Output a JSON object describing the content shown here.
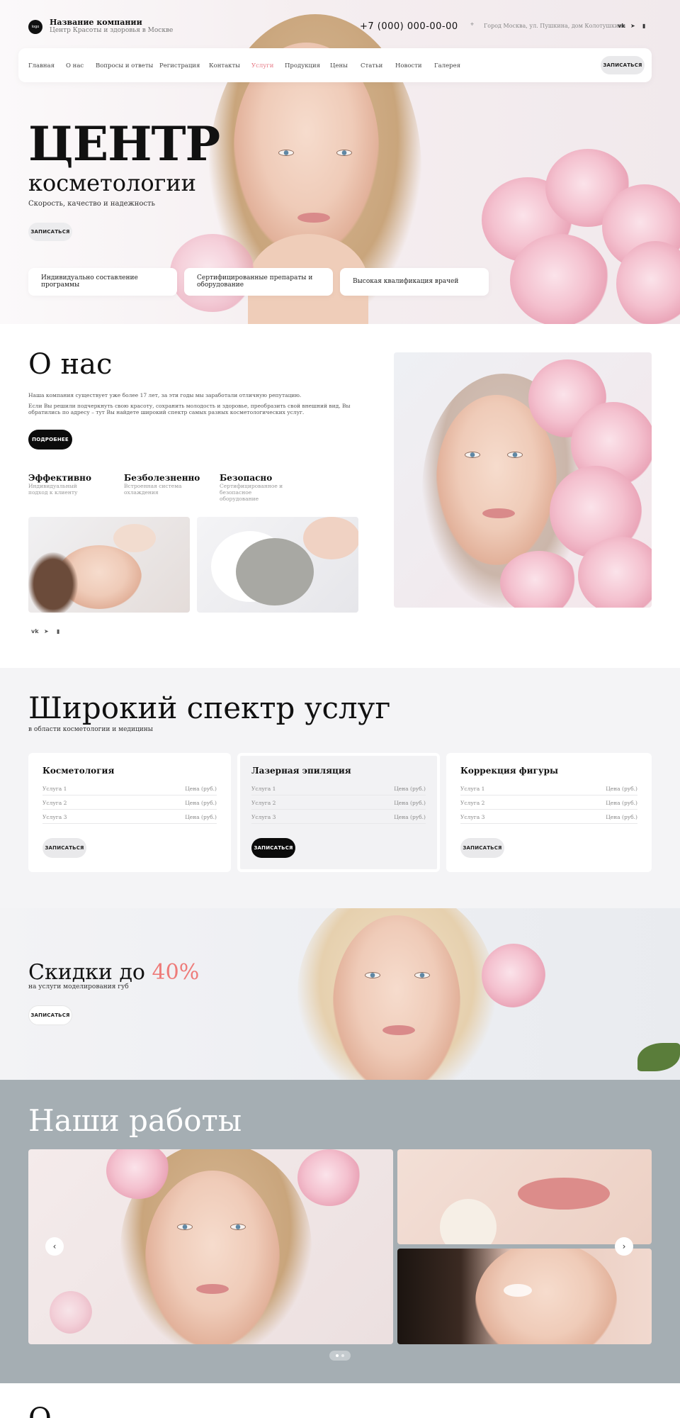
{
  "header": {
    "logo_text": "logo",
    "company_name": "Название компании",
    "company_sub": "Центр Красоты и здоровья в Москве",
    "phone": "+7 (000) 000-00-00",
    "address": "Город Москва, ул. Пушкина, дом Колотушкина",
    "social_icons": [
      "vk-icon",
      "telegram-icon",
      "phone-icon"
    ]
  },
  "nav": {
    "items": [
      {
        "label": "Главная",
        "active": false
      },
      {
        "label": "О нас",
        "active": false
      },
      {
        "label": "Вопросы и ответы",
        "active": false
      },
      {
        "label": "Регистрация",
        "active": false
      },
      {
        "label": "Контакты",
        "active": false
      },
      {
        "label": "Услуги",
        "active": true
      },
      {
        "label": "Продукция",
        "active": false
      },
      {
        "label": "Цены",
        "active": false
      },
      {
        "label": "Статьи",
        "active": false
      },
      {
        "label": "Новости",
        "active": false
      },
      {
        "label": "Галерея",
        "active": false
      }
    ],
    "cta_label": "ЗАПИСАТЬСЯ",
    "active_color": "#e77a86"
  },
  "hero": {
    "title": "ЦЕНТР",
    "subtitle": "косметологии",
    "tagline": "Скорость, качество и надежность",
    "cta_label": "ЗАПИСАТЬСЯ",
    "cards": [
      "Индивидуально составление программы",
      "Сертифицированные препараты и оборудование",
      "Высокая квалификация врачей"
    ]
  },
  "about": {
    "title": "О нас",
    "p1": "Наша компания существует уже более 17 лет, за эти годы мы заработали отличную репутацию.",
    "p2": "Если Вы решили подчеркнуть свою красоту, сохранить молодость и здоровье, преобразить свой внешний вид, Вы обратились по адресу – тут Вы найдете широкий спектр самых разных косметологических услуг.",
    "more_label": "ПОДРОБНЕЕ",
    "features": [
      {
        "title": "Эффективно",
        "desc": "Индивидуальный подход к клиенту"
      },
      {
        "title": "Безболезненно",
        "desc": "Встроенная система охлаждения"
      },
      {
        "title": "Безопасно",
        "desc": "Сертифицированное и безопасное оборудование"
      }
    ],
    "social_icons": [
      "vk-icon",
      "telegram-icon",
      "phone-icon"
    ]
  },
  "services": {
    "title": "Широкий спектр услуг",
    "subtitle": "в области косметологии и медицины",
    "cards": [
      {
        "title": "Косметология",
        "rows": [
          {
            "name": "Услуга 1",
            "price": "Цена (руб.)"
          },
          {
            "name": "Услуга 2",
            "price": "Цена (руб.)"
          },
          {
            "name": "Услуга 3",
            "price": "Цена (руб.)"
          }
        ],
        "cta": "ЗАПИСАТЬСЯ"
      },
      {
        "title": "Лазерная эпиляция",
        "rows": [
          {
            "name": "Услуга 1",
            "price": "Цена (руб.)"
          },
          {
            "name": "Услуга 2",
            "price": "Цена (руб.)"
          },
          {
            "name": "Услуга 3",
            "price": "Цена (руб.)"
          }
        ],
        "cta": "ЗАПИСАТЬСЯ"
      },
      {
        "title": "Коррекция фигуры",
        "rows": [
          {
            "name": "Услуга 1",
            "price": "Цена (руб.)"
          },
          {
            "name": "Услуга 2",
            "price": "Цена (руб.)"
          },
          {
            "name": "Услуга 3",
            "price": "Цена (руб.)"
          }
        ],
        "cta": "ЗАПИСАТЬСЯ"
      }
    ]
  },
  "discount": {
    "title": "Скидки до",
    "percent": "40%",
    "subtitle": "на услуги моделирования губ",
    "cta_label": "ЗАПИСАТЬСЯ",
    "accent_color": "#ee7b79"
  },
  "works": {
    "title": "Наши работы",
    "prev_icon": "‹",
    "next_icon": "›"
  },
  "next_section": {
    "title": "О"
  }
}
